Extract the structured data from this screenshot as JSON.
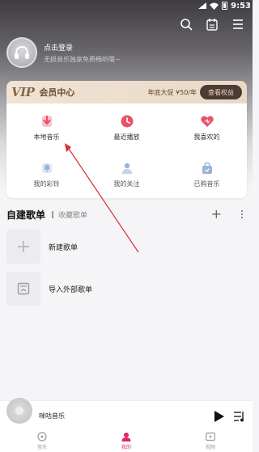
{
  "status_bar": {
    "time": "9:53"
  },
  "profile": {
    "login_text": "点击登录",
    "subtitle": "无损音乐独家免费畅听哦~"
  },
  "vip": {
    "logo": "VIP",
    "title": "会员中心",
    "promo": "年底大促 ¥50/年",
    "button": "查看权益",
    "accent": "#4a3b35"
  },
  "grid": [
    {
      "label": "本地音乐",
      "icon": "download-icon",
      "color": "#e8536b"
    },
    {
      "label": "最近播放",
      "icon": "clock-icon",
      "color": "#e8536b"
    },
    {
      "label": "我喜欢的",
      "icon": "heart-icon",
      "color": "#e8536b"
    },
    {
      "label": "我的彩铃",
      "icon": "bell-icon",
      "color": "#9bb3d6"
    },
    {
      "label": "我的关注",
      "icon": "person-icon",
      "color": "#9bb3d6"
    },
    {
      "label": "已购音乐",
      "icon": "bag-icon",
      "color": "#9bb3d6"
    }
  ],
  "playlists": {
    "tab_created": "自建歌单",
    "tab_collected": "收藏歌单",
    "create_label": "新建歌单",
    "import_label": "导入外部歌单"
  },
  "player": {
    "song": "咪咕音乐"
  },
  "tabs": [
    {
      "label": "音乐",
      "icon": "music-disc-icon"
    },
    {
      "label": "我的",
      "icon": "user-icon",
      "active": true
    },
    {
      "label": "视频",
      "icon": "video-icon"
    }
  ]
}
